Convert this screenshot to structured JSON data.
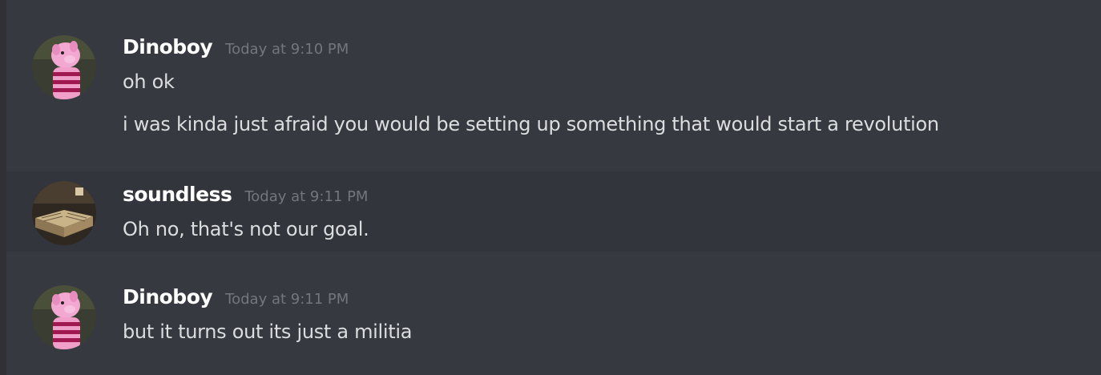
{
  "messages": [
    {
      "username": "Dinoboy",
      "timestamp": "Today at 9:10 PM",
      "avatar_icon": "pig-avatar-icon",
      "lines": [
        "oh ok",
        "i was kinda just afraid you would be setting up something that would start a revolution"
      ]
    },
    {
      "username": "soundless",
      "timestamp": "Today at 9:11 PM",
      "avatar_icon": "books-avatar-icon",
      "lines": [
        "Oh no, that's not our goal."
      ]
    },
    {
      "username": "Dinoboy",
      "timestamp": "Today at 9:11 PM",
      "avatar_icon": "pig-avatar-icon",
      "lines": [
        "but it turns out its just a militia"
      ]
    }
  ],
  "colors": {
    "background": "#36393f",
    "hover_background": "#32353b",
    "username": "#ffffff",
    "timestamp": "#72767d",
    "message_text": "#dcddde"
  }
}
